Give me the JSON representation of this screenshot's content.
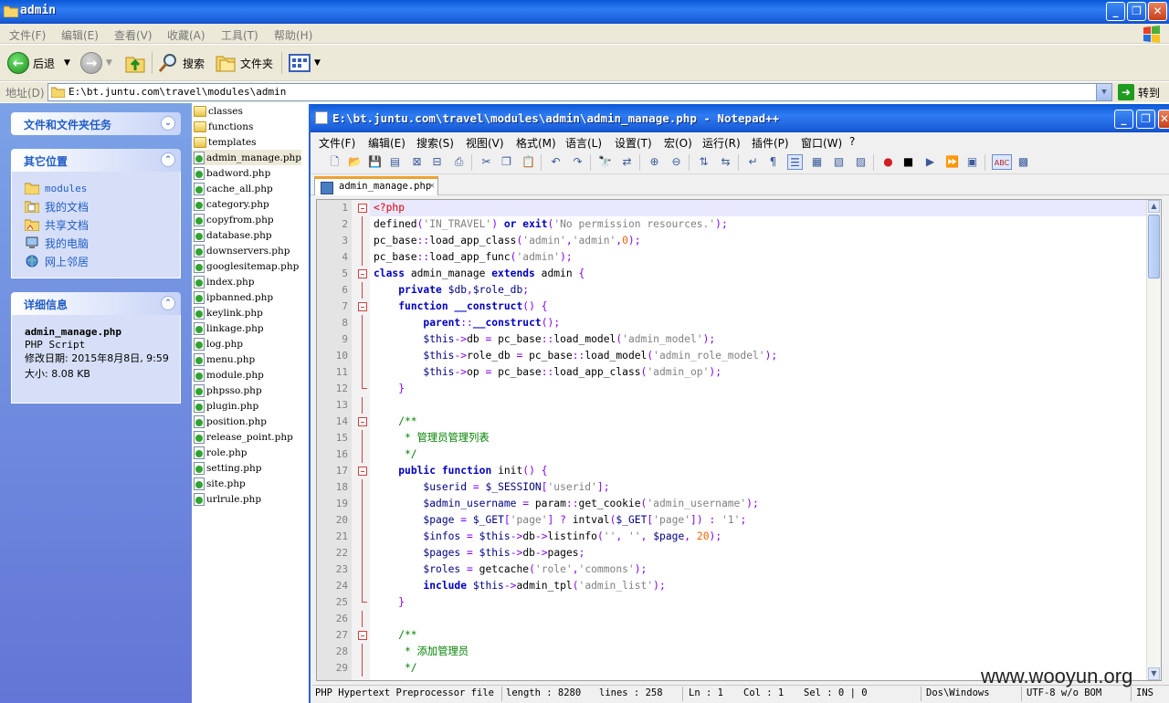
{
  "explorer": {
    "title": "admin",
    "caption_buttons": [
      "_",
      "❐",
      "✕"
    ],
    "menu": [
      "文件(F)",
      "编辑(E)",
      "查看(V)",
      "收藏(A)",
      "工具(T)",
      "帮助(H)"
    ],
    "toolbar": {
      "back": "后退",
      "search": "搜索",
      "folders": "文件夹"
    },
    "address_label": "地址(D)",
    "address_value": "E:\\bt.juntu.com\\travel\\modules\\admin",
    "go_label": "转到",
    "panels": {
      "tasks_title": "文件和文件夹任务",
      "other_title": "其它位置",
      "other_places": [
        "modules",
        "我的文档",
        "共享文档",
        "我的电脑",
        "网上邻居"
      ],
      "details_title": "详细信息",
      "detail_name": "admin_manage.php",
      "detail_type": "PHP Script",
      "detail_modified": "修改日期: 2015年8月8日, 9:59",
      "detail_size": "大小: 8.08 KB"
    },
    "files": [
      {
        "name": "classes",
        "type": "folder"
      },
      {
        "name": "functions",
        "type": "folder"
      },
      {
        "name": "templates",
        "type": "folder"
      },
      {
        "name": "admin_manage.php",
        "type": "php",
        "selected": true
      },
      {
        "name": "badword.php",
        "type": "php"
      },
      {
        "name": "cache_all.php",
        "type": "php"
      },
      {
        "name": "category.php",
        "type": "php"
      },
      {
        "name": "copyfrom.php",
        "type": "php"
      },
      {
        "name": "database.php",
        "type": "php"
      },
      {
        "name": "downservers.php",
        "type": "php"
      },
      {
        "name": "googlesitemap.php",
        "type": "php"
      },
      {
        "name": "index.php",
        "type": "php"
      },
      {
        "name": "ipbanned.php",
        "type": "php"
      },
      {
        "name": "keylink.php",
        "type": "php"
      },
      {
        "name": "linkage.php",
        "type": "php"
      },
      {
        "name": "log.php",
        "type": "php"
      },
      {
        "name": "menu.php",
        "type": "php"
      },
      {
        "name": "module.php",
        "type": "php"
      },
      {
        "name": "phpsso.php",
        "type": "php"
      },
      {
        "name": "plugin.php",
        "type": "php"
      },
      {
        "name": "position.php",
        "type": "php"
      },
      {
        "name": "release_point.php",
        "type": "php"
      },
      {
        "name": "role.php",
        "type": "php"
      },
      {
        "name": "setting.php",
        "type": "php"
      },
      {
        "name": "site.php",
        "type": "php"
      },
      {
        "name": "urlrule.php",
        "type": "php"
      }
    ]
  },
  "npp": {
    "title": "E:\\bt.juntu.com\\travel\\modules\\admin\\admin_manage.php - Notepad++",
    "menu": [
      "文件(F)",
      "编辑(E)",
      "搜索(S)",
      "视图(V)",
      "格式(M)",
      "语言(L)",
      "设置(T)",
      "宏(O)",
      "运行(R)",
      "插件(P)",
      "窗口(W)",
      "?"
    ],
    "tab_label": "admin_manage.php",
    "code_lines": [
      "<?php",
      "defined('IN_TRAVEL') or exit('No permission resources.');",
      "pc_base::load_app_class('admin','admin',0);",
      "pc_base::load_app_func('admin');",
      "class admin_manage extends admin {",
      "    private $db,$role_db;",
      "    function __construct() {",
      "        parent::__construct();",
      "        $this->db = pc_base::load_model('admin_model');",
      "        $this->role_db = pc_base::load_model('admin_role_model');",
      "        $this->op = pc_base::load_app_class('admin_op');",
      "    }",
      "",
      "    /**",
      "     * 管理员管理列表",
      "     */",
      "    public function init() {",
      "        $userid = $_SESSION['userid'];",
      "        $admin_username = param::get_cookie('admin_username');",
      "        $page = $_GET['page'] ? intval($_GET['page']) : '1';",
      "        $infos = $this->db->listinfo('', '', $page, 20);",
      "        $pages = $this->db->pages;",
      "        $roles = getcache('role','commons');",
      "        include $this->admin_tpl('admin_list');",
      "    }",
      "",
      "    /**",
      "     * 添加管理员",
      "     */"
    ],
    "status": {
      "lang": "PHP Hypertext Preprocessor file",
      "length": "length : 8280",
      "lines": "lines : 258",
      "ln": "Ln : 1",
      "col": "Col : 1",
      "sel": "Sel : 0 | 0",
      "eol": "Dos\\Windows",
      "encoding": "UTF-8 w/o BOM",
      "mode": "INS"
    }
  },
  "watermark": "www.wooyun.org"
}
